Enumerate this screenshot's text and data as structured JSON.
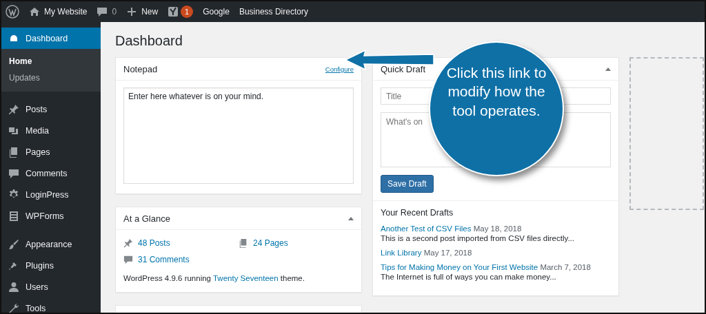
{
  "admin_bar": {
    "site": "My Website",
    "comments": "0",
    "new": "New",
    "seo_badge": "1",
    "links": [
      "Google",
      "Business Directory"
    ]
  },
  "sidebar": {
    "groups": [
      [
        {
          "label": "Dashboard",
          "selected": true,
          "children": [
            {
              "label": "Home",
              "selected": true
            },
            {
              "label": "Updates",
              "selected": false
            }
          ]
        }
      ],
      [
        {
          "label": "Posts",
          "selected": false
        },
        {
          "label": "Media",
          "selected": false
        },
        {
          "label": "Pages",
          "selected": false
        },
        {
          "label": "Comments",
          "selected": false
        },
        {
          "label": "LoginPress",
          "selected": false
        },
        {
          "label": "WPForms",
          "selected": false
        }
      ],
      [
        {
          "label": "Appearance",
          "selected": false
        },
        {
          "label": "Plugins",
          "selected": false
        },
        {
          "label": "Users",
          "selected": false
        },
        {
          "label": "Tools",
          "selected": false
        }
      ]
    ]
  },
  "page_title": "Dashboard",
  "notepad": {
    "title": "Notepad",
    "configure_link": "Configure",
    "text": "Enter here whatever is on your mind."
  },
  "at_a_glance": {
    "title": "At a Glance",
    "stats": [
      "48 Posts",
      "24 Pages",
      "31 Comments"
    ],
    "version_before": "WordPress 4.9.6 running ",
    "theme_link": "Twenty Seventeen",
    "version_after": " theme."
  },
  "quick_draft": {
    "title": "Quick Draft",
    "title_placeholder": "Title",
    "content_placeholder": "What's on",
    "save_button": "Save Draft",
    "recent_heading": "Your Recent Drafts",
    "drafts": [
      {
        "title": "Another Test of CSV Files",
        "date": "May 18, 2018",
        "excerpt": "This is a second post imported from CSV files directly..."
      },
      {
        "title": "Link Library",
        "date": "May 17, 2018"
      },
      {
        "title": "Tips for Making Money on Your First Website",
        "date": "March 7, 2018",
        "excerpt": "The Internet is full of ways you can make money..."
      }
    ]
  },
  "callout": {
    "text": "Click this link to modify how the tool operates."
  }
}
